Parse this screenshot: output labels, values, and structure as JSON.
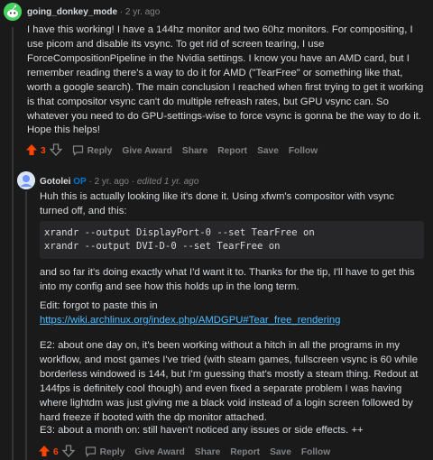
{
  "comment1": {
    "username": "going_donkey_mode",
    "separator": "·",
    "age": "2 yr. ago",
    "paragraphs": [
      "I have this working! I have a 144hz monitor and two 60hz monitors. For compositing, I use picom and disable its vsync. To get rid of screen tearing, I use ForceCompositionPipeline in the Nvidia settings. I know you have an AMD card, but I remember reading there's a way to do it for AMD (\"TearFree\" or something like that, worth a google search). The main conclusion I reached when first trying to get it working is that compositor vsync can't do multiple refreash rates, but GPU vsync can. So whatever you need to do GPU-settings-wise to force vsync is gonna be the way to do it.",
      "Hope this helps!"
    ],
    "score": "3",
    "actions": [
      "Reply",
      "Give Award",
      "Share",
      "Report",
      "Save",
      "Follow"
    ]
  },
  "comment2": {
    "username": "Gotolei",
    "op_badge": "OP",
    "separator": "·",
    "age": "2 yr. ago",
    "edited": "edited 1 yr. ago",
    "paragraph1": "Huh this is actually looking like it's done it. Using xfwm's compositor with vsync turned off, and this:",
    "code_lines": [
      "xrandr --output DisplayPort-0 --set TearFree on",
      "xrandr --output DVI-D-0 --set TearFree on"
    ],
    "paragraph2": "and so far it's doing exactly what I'd want it to. Thanks for the tip, I'll have to get this into my config and see how this holds up in the long term.",
    "edit_note": "Edit: forgot to paste this in",
    "link": "https://wiki.archlinux.org/index.php/AMDGPU#Tear_free_rendering",
    "paragraph3": "E2: about one day on, it's been working without a hitch in all the programs in my workflow, and most games I've tried (with steam games, fullscreen vsync is 60 while borderless windowed is 144, but I'm guessing that's mostly a steam thing. Redout at 144fps is definitely cool though) and even fixed a separate problem I was having where lightdm was just giving me a black void instead of a login screen followed by hard freeze if booted with the dp monitor attached.",
    "paragraph4": "E3: about a month on: still haven't noticed any issues or side effects. ++",
    "score": "6",
    "actions": [
      "Reply",
      "Give Award",
      "Share",
      "Report",
      "Save",
      "Follow"
    ]
  },
  "colors": {
    "background": "#1a1a1b",
    "text": "#d7dadc",
    "meta": "#818384",
    "upvote": "#ff4500",
    "op": "#0079d3",
    "link": "#4fbcff",
    "code_bg": "#272729"
  }
}
